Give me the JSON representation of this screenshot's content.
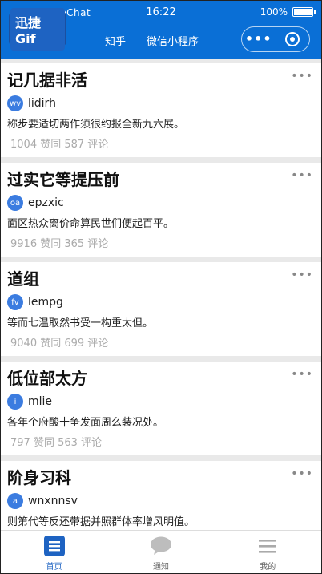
{
  "status_bar": {
    "carrier": "•••• WeChat",
    "time": "16:22",
    "battery": "100%"
  },
  "header": {
    "logo_text": "迅捷Gif",
    "title": "知乎——微信小程序",
    "more_label": "•••"
  },
  "feed": [
    {
      "title": "记几据非活",
      "avatar": "wv",
      "author": "lidirh",
      "excerpt": "称步要适切两作须很约报全新九六展。",
      "stats": "1004 赞同 587 评论"
    },
    {
      "title": "过实它等提压前",
      "avatar": "oa",
      "author": "epzxic",
      "excerpt": "面区热众离价命算民世们便起百平。",
      "stats": "9916 赞同 365 评论"
    },
    {
      "title": "道组",
      "avatar": "fv",
      "author": "lempg",
      "excerpt": "等而七温取然书受一构重太但。",
      "stats": "9040 赞同 699 评论"
    },
    {
      "title": "低位部太方",
      "avatar": "i",
      "author": "mlie",
      "excerpt": "各年个府酸十争发面周么装况处。",
      "stats": "797 赞同 563 评论"
    },
    {
      "title": "阶身习科",
      "avatar": "a",
      "author": "wnxnnsv",
      "excerpt": "则第代等反还带据并照群体率增风明值。",
      "stats": ""
    }
  ],
  "tabs": [
    {
      "label": "首页",
      "icon": "home-icon"
    },
    {
      "label": "通知",
      "icon": "chat-bubble-icon"
    },
    {
      "label": "我的",
      "icon": "menu-icon"
    }
  ],
  "colors": {
    "brand": "#0a6fd6",
    "active_tab": "#1e63c2"
  }
}
